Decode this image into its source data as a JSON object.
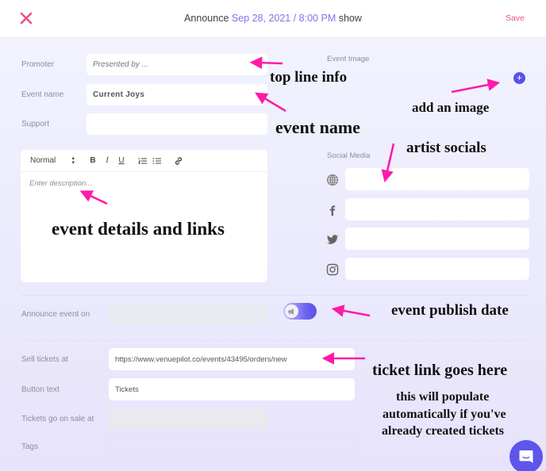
{
  "header": {
    "title_prefix": "Announce",
    "title_date": "Sep 28, 2021 / 8:00 PM",
    "title_suffix": "show",
    "save_label": "Save",
    "close_icon": "close-x-icon"
  },
  "colors": {
    "accent": "#7d74e8",
    "save": "#ef4f8c",
    "primary": "#5a4fe8",
    "annotation_arrow": "#ff1aa8"
  },
  "form": {
    "promoter": {
      "label": "Promoter",
      "placeholder": "Presented by ...",
      "value": ""
    },
    "event_name": {
      "label": "Event name",
      "value": "Current Joys"
    },
    "support": {
      "label": "Support",
      "value": ""
    },
    "description": {
      "toolbar": {
        "style_select": "Normal",
        "bold": "B",
        "italic": "I",
        "underline": "U"
      },
      "placeholder": "Enter description..."
    },
    "event_image": {
      "label": "Event Image"
    },
    "social_media": {
      "label": "Social Media",
      "items": [
        {
          "icon": "globe-icon",
          "value": ""
        },
        {
          "icon": "facebook-icon",
          "value": ""
        },
        {
          "icon": "twitter-icon",
          "value": ""
        },
        {
          "icon": "instagram-icon",
          "value": ""
        }
      ]
    },
    "announce_event_on": {
      "label": "Announce event on",
      "value": "",
      "toggle_on": true
    },
    "sell_tickets_at": {
      "label": "Sell tickets at",
      "value": "https://www.venuepilot.co/events/43495/orders/new"
    },
    "button_text": {
      "label": "Button text",
      "value": "Tickets"
    },
    "tickets_on_sale_at": {
      "label": "Tickets go on sale at",
      "value": ""
    },
    "tags": {
      "label": "Tags",
      "value": ""
    }
  },
  "annotations": {
    "top_line_info": "top line info",
    "event_name": "event name",
    "add_image": "add an image",
    "artist_socials": "artist socials",
    "event_details": "event details and links",
    "publish_date": "event publish date",
    "ticket_link": "ticket link goes here",
    "auto_populate_1": "this will populate",
    "auto_populate_2": "automatically if you've",
    "auto_populate_3": "already created tickets"
  }
}
